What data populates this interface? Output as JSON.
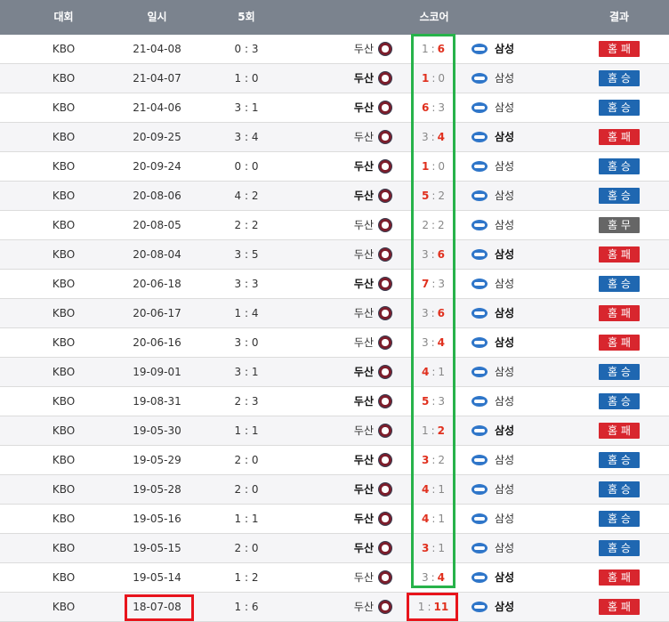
{
  "header": {
    "competition": "대회",
    "date": "일시",
    "five_inning": "5회",
    "score": "스코어",
    "result": "결과"
  },
  "colors": {
    "header_bg": "#7b838e",
    "lose": "#d8262e",
    "win": "#1f67b1",
    "draw": "#666666",
    "score_red": "#e0301e",
    "highlight_green": "#27b24a",
    "highlight_red": "#e8141c"
  },
  "icons": {
    "home_logo": "doosan-bears-logo-icon",
    "away_logo": "samsung-lions-logo-icon"
  },
  "rows": [
    {
      "comp": "KBO",
      "date": "21-04-08",
      "five": "0 : 3",
      "home": "두산",
      "hs": "1",
      "as": "6",
      "sep": ":",
      "away": "삼성",
      "result": "홈 패",
      "type": "lose"
    },
    {
      "comp": "KBO",
      "date": "21-04-07",
      "five": "1 : 0",
      "home": "두산",
      "hs": "1",
      "as": "0",
      "sep": ":",
      "away": "삼성",
      "result": "홈 승",
      "type": "win"
    },
    {
      "comp": "KBO",
      "date": "21-04-06",
      "five": "3 : 1",
      "home": "두산",
      "hs": "6",
      "as": "3",
      "sep": ":",
      "away": "삼성",
      "result": "홈 승",
      "type": "win"
    },
    {
      "comp": "KBO",
      "date": "20-09-25",
      "five": "3 : 4",
      "home": "두산",
      "hs": "3",
      "as": "4",
      "sep": ":",
      "away": "삼성",
      "result": "홈 패",
      "type": "lose"
    },
    {
      "comp": "KBO",
      "date": "20-09-24",
      "five": "0 : 0",
      "home": "두산",
      "hs": "1",
      "as": "0",
      "sep": ":",
      "away": "삼성",
      "result": "홈 승",
      "type": "win"
    },
    {
      "comp": "KBO",
      "date": "20-08-06",
      "five": "4 : 2",
      "home": "두산",
      "hs": "5",
      "as": "2",
      "sep": ":",
      "away": "삼성",
      "result": "홈 승",
      "type": "win"
    },
    {
      "comp": "KBO",
      "date": "20-08-05",
      "five": "2 : 2",
      "home": "두산",
      "hs": "2",
      "as": "2",
      "sep": ":",
      "away": "삼성",
      "result": "홈 무",
      "type": "draw"
    },
    {
      "comp": "KBO",
      "date": "20-08-04",
      "five": "3 : 5",
      "home": "두산",
      "hs": "3",
      "as": "6",
      "sep": ":",
      "away": "삼성",
      "result": "홈 패",
      "type": "lose"
    },
    {
      "comp": "KBO",
      "date": "20-06-18",
      "five": "3 : 3",
      "home": "두산",
      "hs": "7",
      "as": "3",
      "sep": ":",
      "away": "삼성",
      "result": "홈 승",
      "type": "win"
    },
    {
      "comp": "KBO",
      "date": "20-06-17",
      "five": "1 : 4",
      "home": "두산",
      "hs": "3",
      "as": "6",
      "sep": ":",
      "away": "삼성",
      "result": "홈 패",
      "type": "lose"
    },
    {
      "comp": "KBO",
      "date": "20-06-16",
      "five": "3 : 0",
      "home": "두산",
      "hs": "3",
      "as": "4",
      "sep": ":",
      "away": "삼성",
      "result": "홈 패",
      "type": "lose"
    },
    {
      "comp": "KBO",
      "date": "19-09-01",
      "five": "3 : 1",
      "home": "두산",
      "hs": "4",
      "as": "1",
      "sep": ":",
      "away": "삼성",
      "result": "홈 승",
      "type": "win"
    },
    {
      "comp": "KBO",
      "date": "19-08-31",
      "five": "2 : 3",
      "home": "두산",
      "hs": "5",
      "as": "3",
      "sep": ":",
      "away": "삼성",
      "result": "홈 승",
      "type": "win"
    },
    {
      "comp": "KBO",
      "date": "19-05-30",
      "five": "1 : 1",
      "home": "두산",
      "hs": "1",
      "as": "2",
      "sep": ":",
      "away": "삼성",
      "result": "홈 패",
      "type": "lose"
    },
    {
      "comp": "KBO",
      "date": "19-05-29",
      "five": "2 : 0",
      "home": "두산",
      "hs": "3",
      "as": "2",
      "sep": ":",
      "away": "삼성",
      "result": "홈 승",
      "type": "win"
    },
    {
      "comp": "KBO",
      "date": "19-05-28",
      "five": "2 : 0",
      "home": "두산",
      "hs": "4",
      "as": "1",
      "sep": ":",
      "away": "삼성",
      "result": "홈 승",
      "type": "win"
    },
    {
      "comp": "KBO",
      "date": "19-05-16",
      "five": "1 : 1",
      "home": "두산",
      "hs": "4",
      "as": "1",
      "sep": ":",
      "away": "삼성",
      "result": "홈 승",
      "type": "win"
    },
    {
      "comp": "KBO",
      "date": "19-05-15",
      "five": "2 : 0",
      "home": "두산",
      "hs": "3",
      "as": "1",
      "sep": ":",
      "away": "삼성",
      "result": "홈 승",
      "type": "win"
    },
    {
      "comp": "KBO",
      "date": "19-05-14",
      "five": "1 : 2",
      "home": "두산",
      "hs": "3",
      "as": "4",
      "sep": ":",
      "away": "삼성",
      "result": "홈 패",
      "type": "lose"
    },
    {
      "comp": "KBO",
      "date": "18-07-08",
      "five": "1 : 6",
      "home": "두산",
      "hs": "1",
      "as": "11",
      "sep": ":",
      "away": "삼성",
      "result": "홈 패",
      "type": "lose"
    }
  ]
}
